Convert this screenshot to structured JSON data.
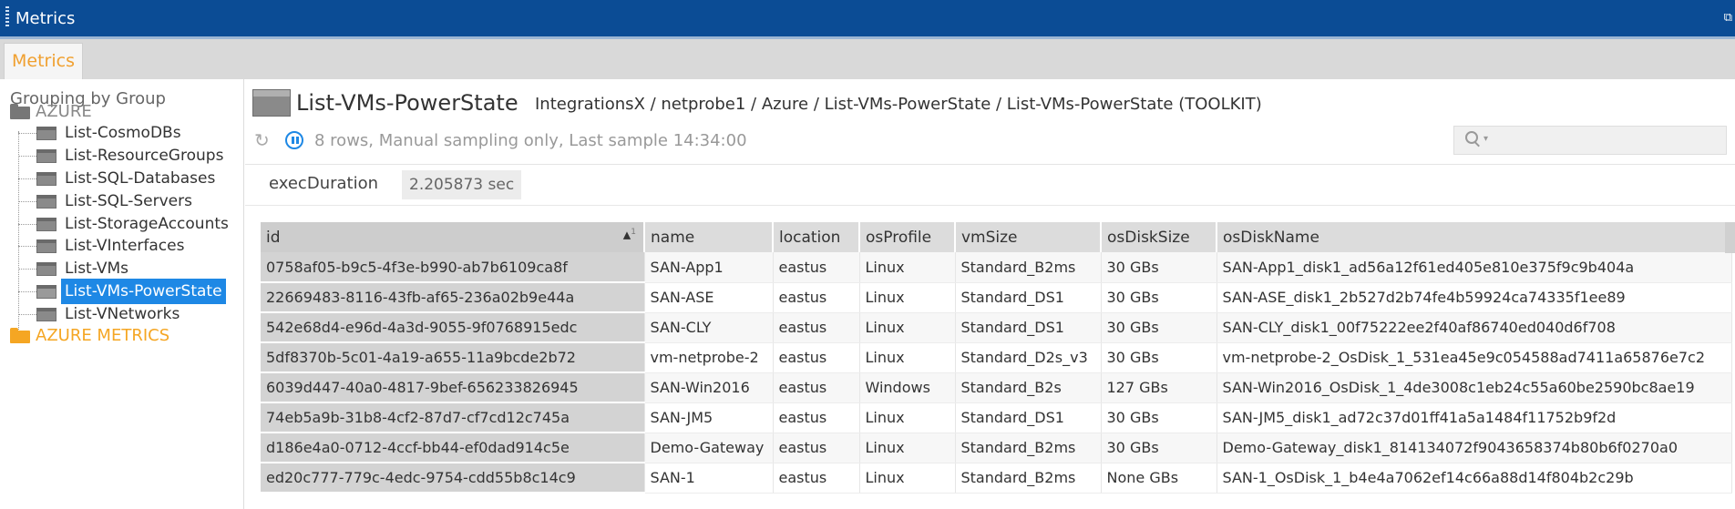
{
  "window": {
    "title": "Metrics",
    "restore_icon": "restore-icon"
  },
  "tabs": [
    {
      "label": "Metrics",
      "active": true
    }
  ],
  "sidebar": {
    "heading": "Grouping by Group",
    "groups": [
      {
        "label": "AZURE",
        "icon": "folder-icon",
        "items": [
          {
            "label": "List-CosmoDBs"
          },
          {
            "label": "List-ResourceGroups"
          },
          {
            "label": "List-SQL-Databases"
          },
          {
            "label": "List-SQL-Servers"
          },
          {
            "label": "List-StorageAccounts"
          },
          {
            "label": "List-VInterfaces"
          },
          {
            "label": "List-VMs"
          },
          {
            "label": "List-VMs-PowerState",
            "selected": true
          },
          {
            "label": "List-VNetworks"
          }
        ]
      },
      {
        "label": "AZURE METRICS",
        "icon": "folder-icon",
        "items": []
      }
    ]
  },
  "view": {
    "title": "List-VMs-PowerState",
    "breadcrumb": "IntegrationsX / netprobe1 / Azure / List-VMs-PowerState / List-VMs-PowerState (TOOLKIT)",
    "status": "8 rows, Manual sampling only, Last sample 14:34:00",
    "search_placeholder": "",
    "headline": {
      "label": "execDuration",
      "value": "2.205873 sec"
    }
  },
  "table": {
    "sort": {
      "column": "id",
      "direction": "ascending",
      "order": "1"
    },
    "columns": [
      "id",
      "name",
      "location",
      "osProfile",
      "vmSize",
      "osDiskSize",
      "osDiskName"
    ],
    "rows": [
      [
        "0758af05-b9c5-4f3e-b990-ab7b6109ca8f",
        "SAN-App1",
        "eastus",
        "Linux",
        "Standard_B2ms",
        "30 GBs",
        "SAN-App1_disk1_ad56a12f61ed405e810e375f9c9b404a"
      ],
      [
        "22669483-8116-43fb-af65-236a02b9e44a",
        "SAN-ASE",
        "eastus",
        "Linux",
        "Standard_DS1",
        "30 GBs",
        "SAN-ASE_disk1_2b527d2b74fe4b59924ca74335f1ee89"
      ],
      [
        "542e68d4-e96d-4a3d-9055-9f0768915edc",
        "SAN-CLY",
        "eastus",
        "Linux",
        "Standard_DS1",
        "30 GBs",
        "SAN-CLY_disk1_00f75222ee2f40af86740ed040d6f708"
      ],
      [
        "5df8370b-5c01-4a19-a655-11a9bcde2b72",
        "vm-netprobe-2",
        "eastus",
        "Linux",
        "Standard_D2s_v3",
        "30 GBs",
        "vm-netprobe-2_OsDisk_1_531ea45e9c054588ad7411a65876e7c2"
      ],
      [
        "6039d447-40a0-4817-9bef-656233826945",
        "SAN-Win2016",
        "eastus",
        "Windows",
        "Standard_B2s",
        "127 GBs",
        "SAN-Win2016_OsDisk_1_4de3008c1eb24c55a60be2590bc8ae19"
      ],
      [
        "74eb5a9b-31b8-4cf2-87d7-cf7cd12c745a",
        "SAN-JM5",
        "eastus",
        "Linux",
        "Standard_DS1",
        "30 GBs",
        "SAN-JM5_disk1_ad72c37d01ff41a5a1484f11752b9f2d"
      ],
      [
        "d186e4a0-0712-4ccf-bb44-ef0dad914c5e",
        "Demo-Gateway",
        "eastus",
        "Linux",
        "Standard_B2ms",
        "30 GBs",
        "Demo-Gateway_disk1_814134072f9043658374b80b6f0270a0"
      ],
      [
        "ed20c777-779c-4edc-9754-cdd55b8c14c9",
        "SAN-1",
        "eastus",
        "Linux",
        "Standard_B2ms",
        "None GBs",
        "SAN-1_OsDisk_1_b4e4a7062ef14c66a88d14f804b2c29b"
      ]
    ]
  }
}
